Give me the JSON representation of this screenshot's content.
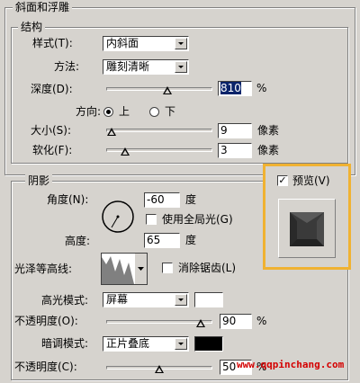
{
  "bevel": {
    "section_title": "斜面和浮雕",
    "structure_title": "结构",
    "style_label": "样式(T):",
    "style_value": "内斜面",
    "technique_label": "方法:",
    "technique_value": "雕刻清晰",
    "depth_label": "深度(D):",
    "depth_value": "810",
    "percent": "%",
    "direction_label": "方向:",
    "direction_up": "上",
    "direction_down": "下",
    "size_label": "大小(S):",
    "size_value": "9",
    "soften_label": "软化(F):",
    "soften_value": "3",
    "pixels": "像素"
  },
  "shading": {
    "title": "阴影",
    "angle_label": "角度(N):",
    "angle_value": "-60",
    "degree": "度",
    "global_light_label": "使用全局光(G)",
    "altitude_label": "高度:",
    "altitude_value": "65",
    "gloss_label": "光泽等高线:",
    "anti_alias_label": "消除锯齿(L)",
    "highlight_mode_label": "高光模式:",
    "highlight_mode_value": "屏幕",
    "highlight_opacity_label": "不透明度(O):",
    "highlight_opacity_value": "90",
    "shadow_mode_label": "暗调模式:",
    "shadow_mode_value": "正片叠底",
    "shadow_opacity_label": "不透明度(C):",
    "shadow_opacity_value": "50",
    "percent": "%"
  },
  "preview": {
    "label": "预览(V)",
    "checked": true
  },
  "watermark": "www.qqpinchang.com",
  "colors": {
    "highlight_color": "#ffffff",
    "shadow_color": "#000000",
    "preview_border": "#f0b232",
    "selection": "#0a246a"
  },
  "levels": {
    "depth_slider": 0.62,
    "size_slider": 0.02,
    "soften_slider": 0.18,
    "highlight_opacity_slider": 0.9,
    "shadow_opacity_slider": 0.5
  }
}
